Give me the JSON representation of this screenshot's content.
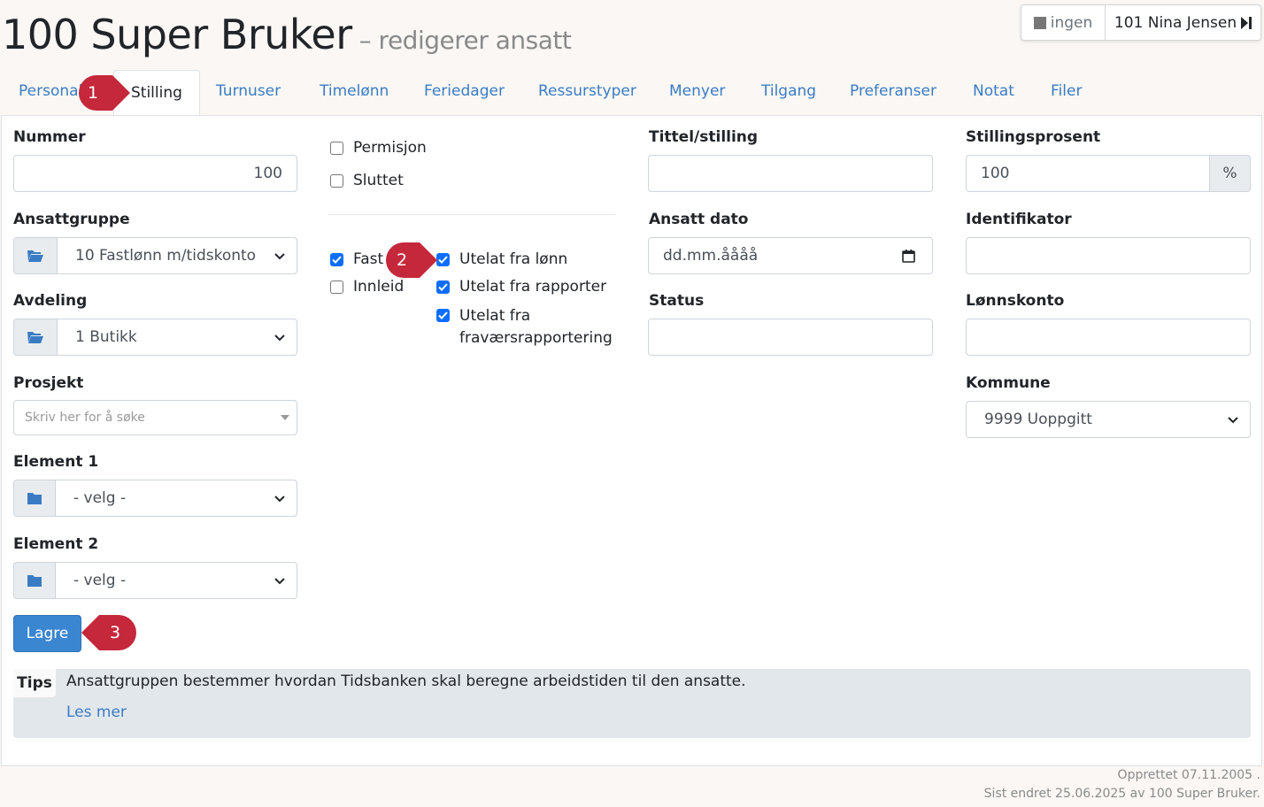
{
  "header": {
    "title": "100 Super Bruker",
    "subtitle": "– redigerer ansatt"
  },
  "employee_nav": {
    "none_label": "ingen",
    "next_employee": "101 Nina Jensen"
  },
  "tabs": [
    {
      "label": "Personalia"
    },
    {
      "label": "Stilling"
    },
    {
      "label": "Turnuser"
    },
    {
      "label": "Timelønn"
    },
    {
      "label": "Feriedager"
    },
    {
      "label": "Ressurstyper"
    },
    {
      "label": "Menyer"
    },
    {
      "label": "Tilgang"
    },
    {
      "label": "Preferanser"
    },
    {
      "label": "Notat"
    },
    {
      "label": "Filer"
    }
  ],
  "form": {
    "nummer": {
      "label": "Nummer",
      "value": "100"
    },
    "ansattgruppe": {
      "label": "Ansattgruppe",
      "value": "10 Fastlønn m/tidskonto"
    },
    "avdeling": {
      "label": "Avdeling",
      "value": "1 Butikk"
    },
    "prosjekt": {
      "label": "Prosjekt",
      "placeholder": "Skriv her for å søke"
    },
    "element1": {
      "label": "Element 1",
      "value": "- velg -"
    },
    "element2": {
      "label": "Element 2",
      "value": "- velg -"
    },
    "permisjon": {
      "label": "Permisjon",
      "checked": false
    },
    "sluttet": {
      "label": "Sluttet",
      "checked": false
    },
    "fast": {
      "label": "Fast",
      "checked": true
    },
    "innleid": {
      "label": "Innleid",
      "checked": false
    },
    "utelat_lonn": {
      "label": "Utelat fra lønn",
      "checked": true
    },
    "utelat_rapporter": {
      "label": "Utelat fra rapporter",
      "checked": true
    },
    "utelat_fravaer": {
      "label_line1": "Utelat fra",
      "label_line2": "fraværsrapportering",
      "checked": true
    },
    "tittel": {
      "label": "Tittel/stilling",
      "value": ""
    },
    "ansatt_dato": {
      "label": "Ansatt dato",
      "placeholder": "dd.mm.åååå"
    },
    "status": {
      "label": "Status",
      "value": ""
    },
    "stillingsprosent": {
      "label": "Stillingsprosent",
      "value": "100",
      "unit": "%"
    },
    "identifikator": {
      "label": "Identifikator",
      "value": ""
    },
    "lonnskonto": {
      "label": "Lønnskonto",
      "value": ""
    },
    "kommune": {
      "label": "Kommune",
      "value": "9999 Uoppgitt"
    },
    "save_label": "Lagre"
  },
  "tips": {
    "tag": "Tips",
    "text": "Ansattgruppen bestemmer hvordan Tidsbanken skal beregne arbeidstiden til den ansatte.",
    "link": "Les mer"
  },
  "footer": {
    "created": "Opprettet 07.11.2005 .",
    "modified": "Sist endret 25.06.2025 av 100 Super Bruker."
  },
  "markers": [
    "1",
    "2",
    "3"
  ],
  "colors": {
    "accent": "#3a86d0",
    "link": "#3a7cc4",
    "marker": "#c5283a",
    "checkbox": "#0d6efd"
  }
}
